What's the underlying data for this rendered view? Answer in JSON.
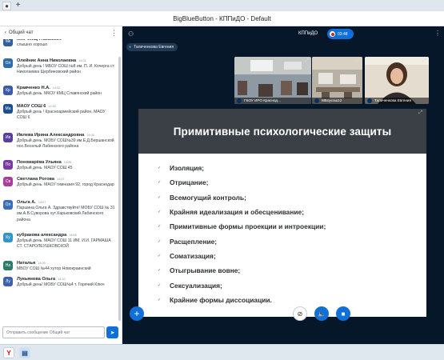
{
  "window": {
    "title": "BigBlueButton - КППиДО - Default"
  },
  "chat": {
    "header_title": "Общий чат",
    "input_placeholder": "Отправить сообщение Общий чат",
    "messages": [
      {
        "initials": "Мк",
        "color": "#355e9e",
        "name": "МКУ ИМЦ Глазовкое",
        "time": "",
        "text": "слышно хорошо"
      },
      {
        "initials": "Ол",
        "color": "#2f6ca8",
        "name": "Олейник Анна Николаевна",
        "time": "14:01",
        "text": "Добрый день ! МБОУ СОШ №8 им. П. И. Кочерга ст. Николаевка Щербиновский район"
      },
      {
        "initials": "Кр",
        "color": "#3d5aa8",
        "name": "Кравченко Н.А.",
        "time": "14:02",
        "text": "Добрый день. МКОУ КМЦ Славянский район"
      },
      {
        "initials": "Ма",
        "color": "#1d4f8f",
        "name": "МАОУ СОШ 6",
        "time": "14:02",
        "text": "Добрый день ! Красноармейский район, МАОУ СОШ 6"
      },
      {
        "initials": "Ив",
        "color": "#5b3f9e",
        "name": "Ивлева Ирина Александровна",
        "time": "14:05",
        "text": "Добрый день. МОБУ СОШ№39 им.Е.Д.Бершанской пос.Веселый Лабинского района"
      },
      {
        "initials": "По",
        "color": "#7a3aa6",
        "name": "Пономарёва Ульяна",
        "time": "14:06",
        "text": "Добрый день. МАОУ СОШ 45"
      },
      {
        "initials": "Св",
        "color": "#a8409a",
        "name": "Светлана Рогова",
        "time": "14:07",
        "text": "Добрый день. МАОУ гимназия 92, город Краснодар"
      },
      {
        "initials": "Ол",
        "color": "#3a6fb6",
        "name": "Ольга А.",
        "time": "14:07",
        "text": "Паршина Ольга А. Здравствуйте! МОБУ СОШ № 31 им.А.В.Суворова хут.Харьковский Лабинского района"
      },
      {
        "initials": "Ку",
        "color": "#3295c6",
        "name": "кубракова александра",
        "time": "14:08",
        "text": "Добрый день. МАОУ СОШ 11 ИМ. И.И. ГАРМАША СТ. СТАРОЛЕУШКОВСКОЙ"
      },
      {
        "initials": "На",
        "color": "#2f7b6b",
        "name": "Наталья",
        "time": "14:09",
        "text": "МБОУ СОШ №44 хутор Новокраинский"
      },
      {
        "initials": "Лу",
        "color": "#3c63a9",
        "name": "Лукьянова Ольга",
        "time": "14:10",
        "text": "Добрый день! МОБУ СОШ№4 т. Горячий Ключ"
      }
    ]
  },
  "main": {
    "conference_name": "КППиДО",
    "recording_time": "03:48",
    "presenter": "Таличенкова Евгения",
    "webcams": [
      {
        "label": "ГБОУ ИРО Краснод...",
        "bg": "#8a9aa5"
      },
      {
        "label": "МБоусош12",
        "bg": "#b8b1a4"
      },
      {
        "label": "Таличенкова Евгения",
        "bg": "#d8cdbd"
      }
    ]
  },
  "slide": {
    "title": "Примитивные психологические защиты",
    "items": [
      "Изоляция;",
      "Отрицание;",
      "Всемогущий контроль;",
      "Крайняя идеализация и обесценивание;",
      "Примитивные формы проекции и интроекции;",
      "Расщепление;",
      "Соматизация;",
      "Отыгрывание вовне;",
      "Сексуализация;",
      "Крайние формы диссоциации."
    ]
  },
  "icons": {
    "user_list": "users-icon",
    "record": "record-icon",
    "more": "more-options-icon",
    "plus": "plus-icon",
    "screen_share": "screen-share-icon",
    "audio": "audio-muted-icon",
    "video": "video-icon"
  },
  "colors": {
    "accent": "#0f70d7",
    "main_bg": "#06172a",
    "slide_header": "#3a4046"
  }
}
